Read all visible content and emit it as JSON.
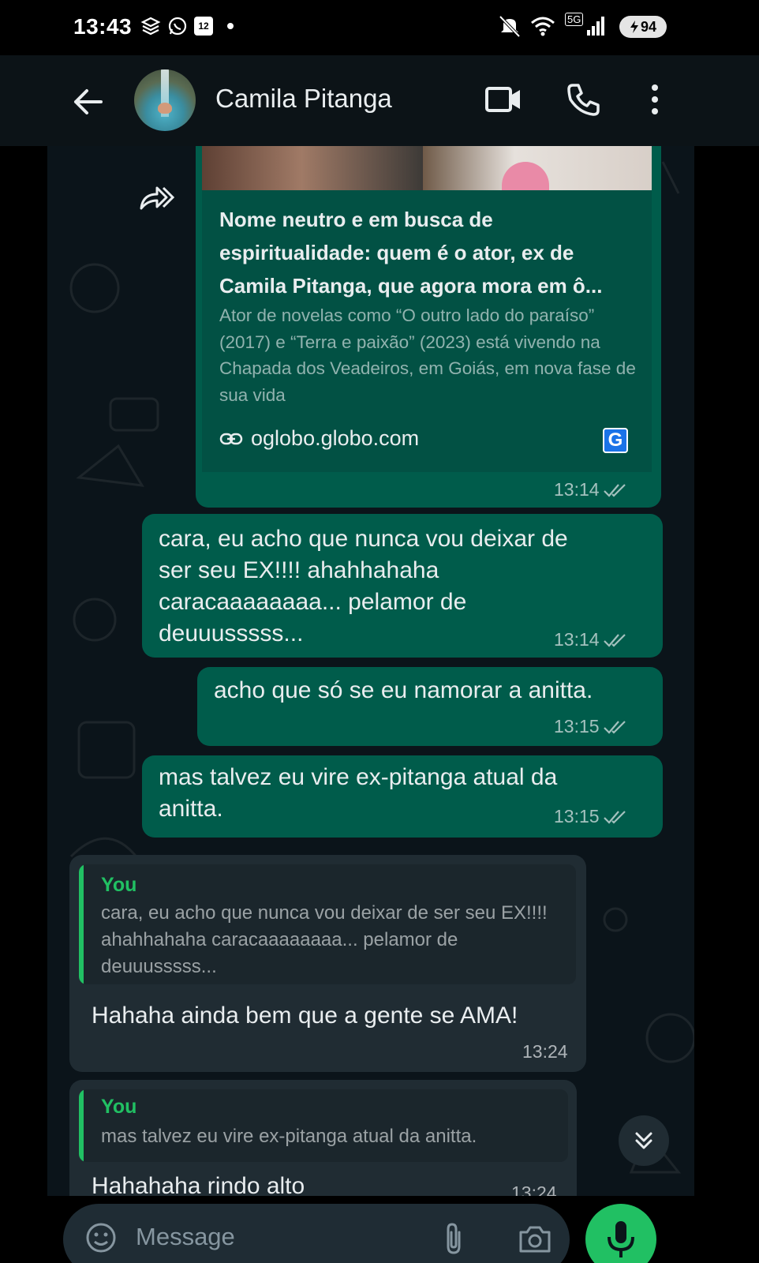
{
  "status_bar": {
    "time": "13:43",
    "calendar_day": "12",
    "network": "5G",
    "battery": "94"
  },
  "header": {
    "contact_name": "Camila Pitanga"
  },
  "messages": {
    "link_preview": {
      "title": "Nome neutro e em busca de espiritualidade: quem é o ator, ex de Camila Pitanga, que agora mora em ô...",
      "description": "Ator de novelas como “O outro lado do paraíso” (2017) e “Terra e paixão” (2023) está vivendo na Chapada dos Veadeiros, em Goiás, em nova fase de sua vida",
      "domain": "oglobo.globo.com",
      "source_badge": "G",
      "time": "13:14"
    },
    "out_1": {
      "text": "cara, eu acho que nunca vou deixar de ser seu EX!!!! ahahhahaha caracaaaaaaaa... pelamor de deuuusssss...",
      "time": "13:14"
    },
    "out_2": {
      "text": "acho que só se eu namorar a anitta.",
      "time": "13:15"
    },
    "out_3": {
      "text": "mas talvez eu vire ex-pitanga atual da anitta.",
      "time": "13:15"
    },
    "in_1": {
      "quote_author": "You",
      "quote_text": "cara, eu acho que nunca vou deixar de ser seu EX!!!! ahahhahaha caracaaaaaaaa... pelamor de deuuusssss...",
      "text": "Hahaha ainda bem que a gente se AMA!",
      "time": "13:24"
    },
    "in_2": {
      "quote_author": "You",
      "quote_text": "mas talvez eu vire ex-pitanga atual da anitta.",
      "text": "Hahahaha rindo alto",
      "time": "13:24"
    }
  },
  "composer": {
    "placeholder": "Message"
  },
  "colors": {
    "outgoing_bubble": "#005c4b",
    "incoming_bubble": "#202c33",
    "accent": "#21c063",
    "background": "#0b141a"
  },
  "icons": [
    "back-arrow-icon",
    "video-call-icon",
    "voice-call-icon",
    "more-vert-icon",
    "forward-icon",
    "link-icon",
    "double-check-icon",
    "scroll-down-icon",
    "emoji-icon",
    "attach-icon",
    "camera-icon",
    "mic-icon"
  ]
}
